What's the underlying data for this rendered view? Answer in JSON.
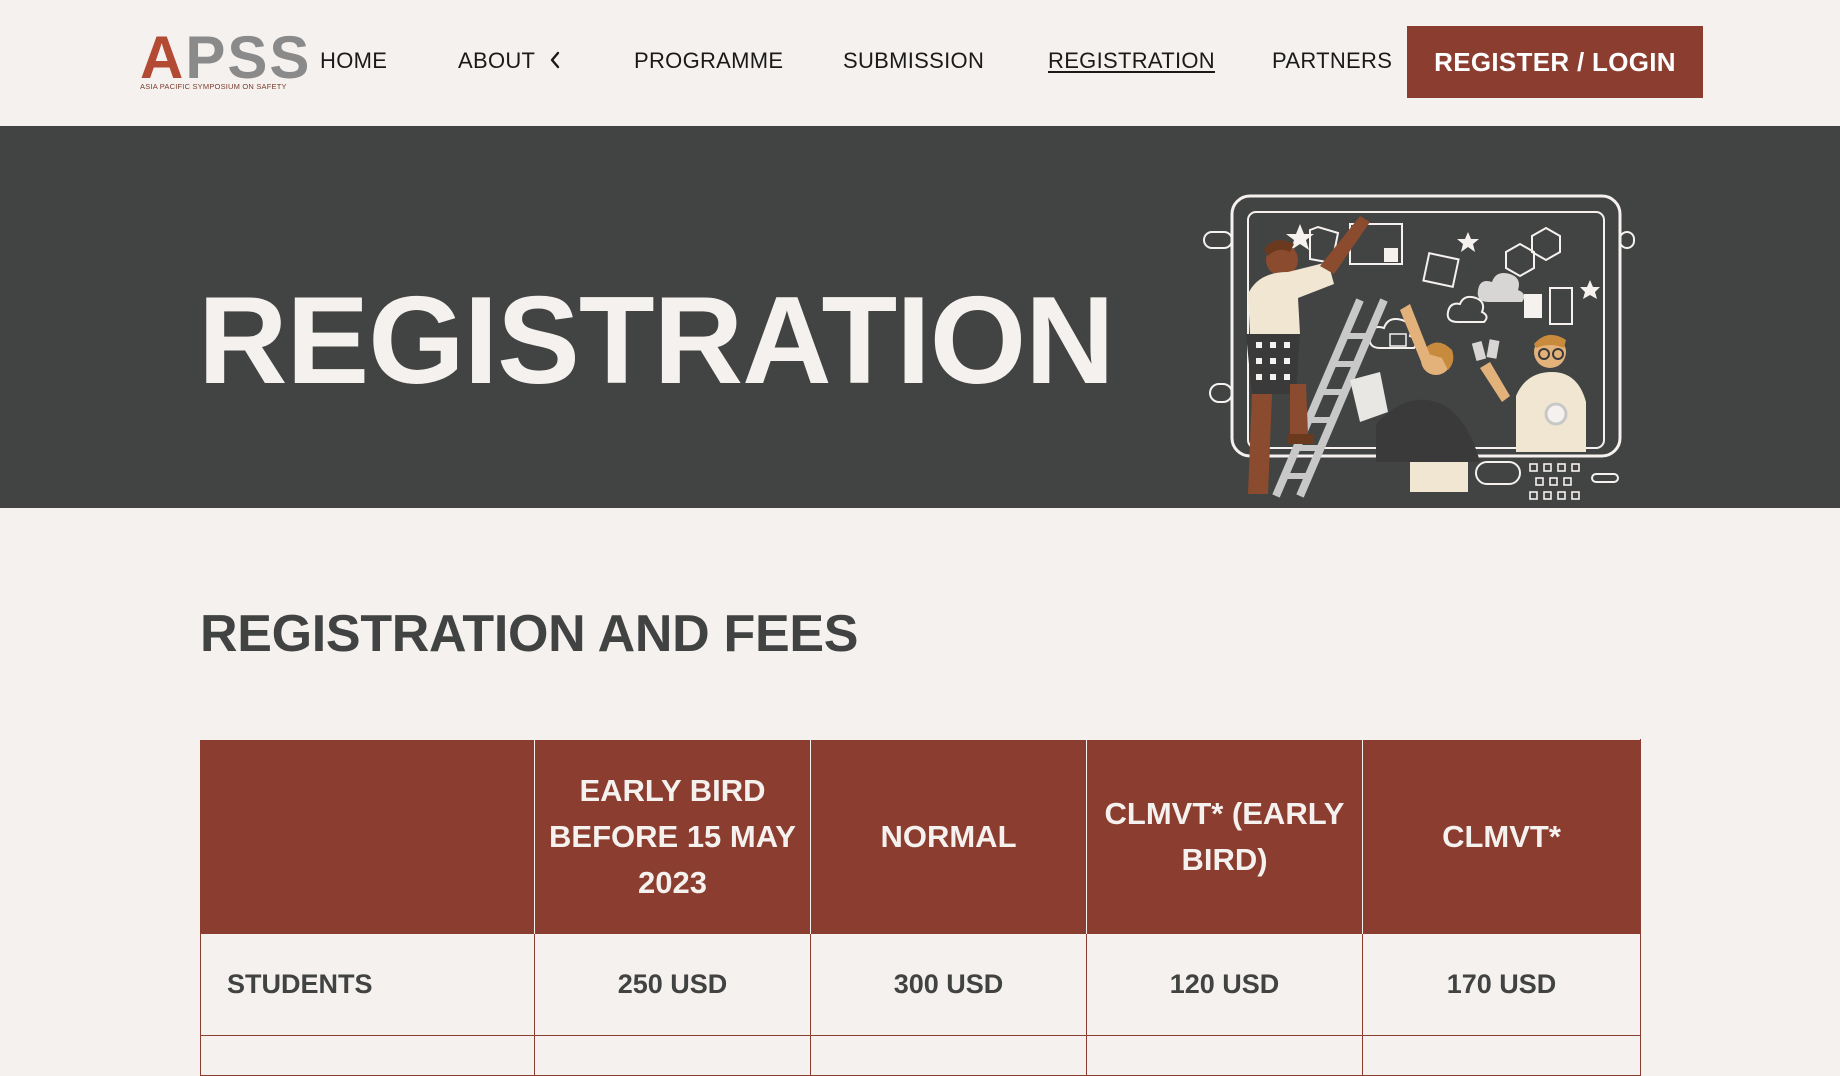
{
  "brand": {
    "logo_text_a": "A",
    "logo_text_rest": "PSS",
    "logo_tagline": "ASIA PACIFIC SYMPOSIUM ON SAFETY",
    "accent": "#8b3d30",
    "dark": "#424444",
    "background": "#f5f1ee"
  },
  "nav": {
    "items": [
      {
        "label": "HOME"
      },
      {
        "label": "ABOUT"
      },
      {
        "label": "PROGRAMME"
      },
      {
        "label": "SUBMISSION"
      },
      {
        "label": "REGISTRATION",
        "active": true
      },
      {
        "label": "PARTNERS"
      }
    ],
    "about_icon": "chevron-left-icon",
    "cta_label": "REGISTER / LOGIN"
  },
  "hero": {
    "title": "REGISTRATION",
    "illustration": "team-planning-board-illustration"
  },
  "section": {
    "title": "REGISTRATION AND FEES"
  },
  "fees_table": {
    "columns": [
      "",
      "EARLY BIRD BEFORE 15 MAY 2023",
      "NORMAL",
      "CLMVT* (EARLY BIRD)",
      "CLMVT*"
    ],
    "rows": [
      {
        "label": "STUDENTS",
        "values": [
          "250 USD",
          "300 USD",
          "120 USD",
          "170 USD"
        ]
      }
    ]
  }
}
